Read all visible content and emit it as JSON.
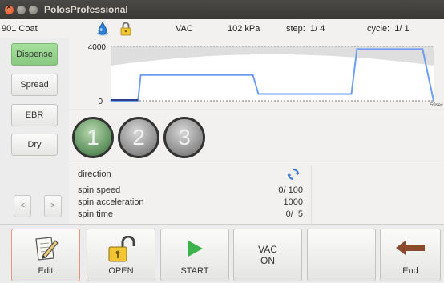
{
  "window": {
    "title": "PolosProfessional"
  },
  "status": {
    "recipe": "901 Coat",
    "vac": "VAC",
    "pressure": "102 kPa",
    "step": "step:  1/ 4",
    "cycle": "cycle:  1/ 1",
    "icons": [
      "water-drop-icon",
      "lock-icon"
    ]
  },
  "left_buttons": [
    {
      "label": "Dispense",
      "active": true
    },
    {
      "label": "Spread",
      "active": false
    },
    {
      "label": "EBR",
      "active": false
    },
    {
      "label": "Dry",
      "active": false
    }
  ],
  "nav": {
    "prev": "<",
    "next": ">"
  },
  "chart_data": {
    "type": "line",
    "title": "",
    "xlabel": "",
    "ylabel": "",
    "y_ticks": [
      "4000",
      "0"
    ],
    "x_end_label": "59sec",
    "ylim": [
      0,
      4000
    ],
    "xlim": [
      0,
      59
    ],
    "series": [
      {
        "color": "#6f9ef0",
        "x": [
          0,
          5,
          5.5,
          26,
          27,
          37,
          38,
          44,
          45,
          56,
          57,
          59
        ],
        "y": [
          0,
          0,
          1900,
          1900,
          500,
          500,
          500,
          500,
          3800,
          3800,
          3800,
          0
        ]
      }
    ]
  },
  "steps": [
    "1",
    "2",
    "3"
  ],
  "info": {
    "direction_label": "direction",
    "spin_speed_label": "spin speed",
    "spin_speed_value": "0/ 100",
    "spin_acceleration_label": "spin acceleration",
    "spin_acceleration_value": "1000",
    "spin_time_label": "spin time",
    "spin_time_value": "0/  5"
  },
  "toolbar": {
    "edit": "Edit",
    "open": "OPEN",
    "start": "START",
    "vac_line1": "VAC",
    "vac_line2": "ON",
    "blank": "",
    "end": "End"
  },
  "colors": {
    "active_green": "#88c97f",
    "series_blue": "#6f9ef0",
    "start_green": "#3cb34a",
    "end_arrow": "#8b4a2b"
  }
}
